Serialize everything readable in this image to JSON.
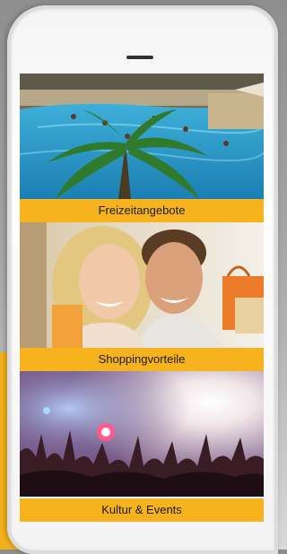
{
  "colors": {
    "accent": "#f6b31d",
    "background": "#a3a3a3",
    "phone_body": "#f4f4f4"
  },
  "tiles": [
    {
      "label": "Freizeitangebote",
      "image": "pool-resort-photo"
    },
    {
      "label": "Shoppingvorteile",
      "image": "shopping-couple-photo"
    },
    {
      "label": "Kultur & Events",
      "image": "concert-crowd-photo"
    }
  ]
}
